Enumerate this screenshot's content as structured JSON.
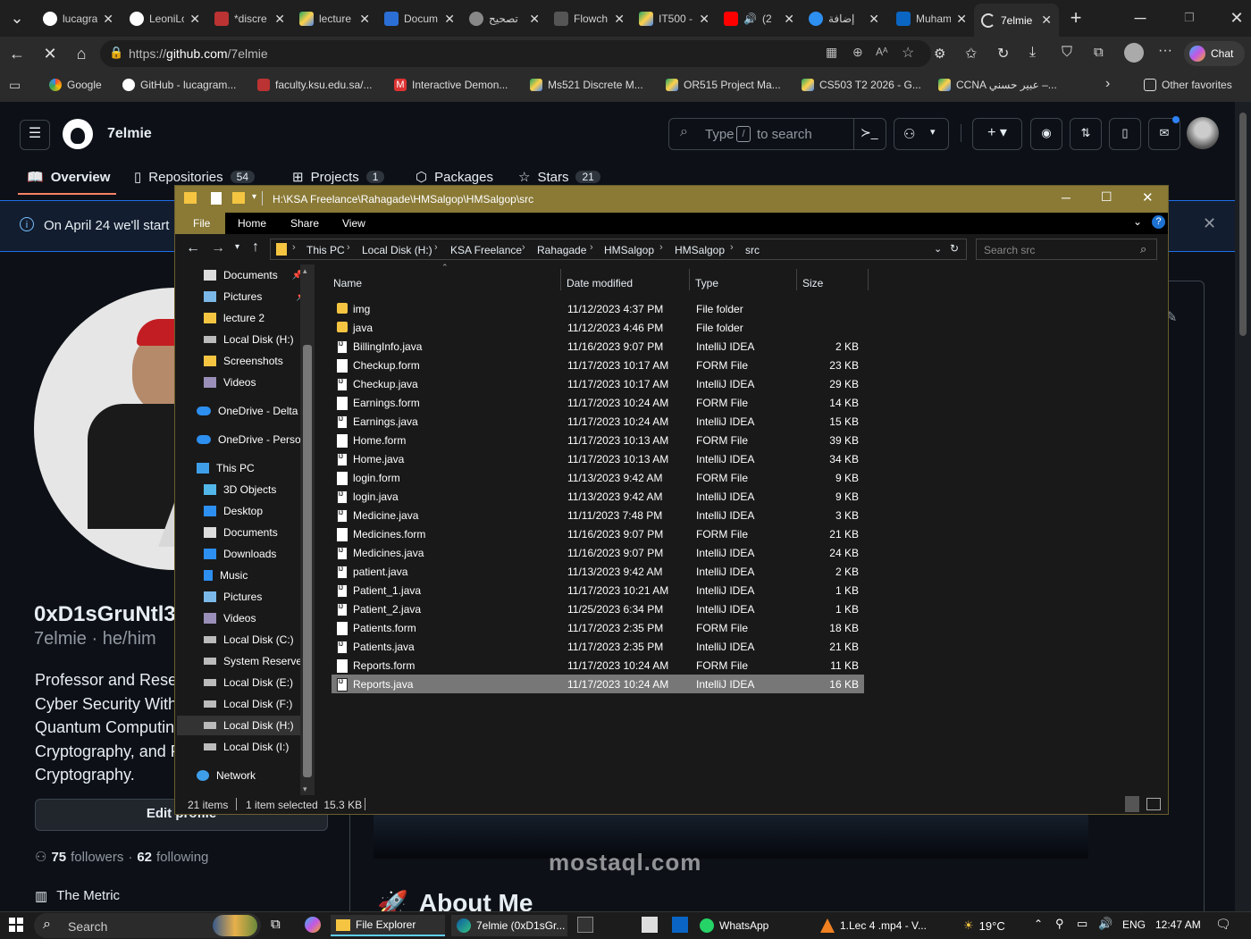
{
  "browser": {
    "tabs": [
      {
        "label": "lucagra"
      },
      {
        "label": "LeoniLo"
      },
      {
        "label": "*discre"
      },
      {
        "label": "lecture"
      },
      {
        "label": "Docum"
      },
      {
        "label": "تصحيح"
      },
      {
        "label": "Flowch"
      },
      {
        "label": "IT500 -"
      },
      {
        "label": "(2"
      },
      {
        "label": "إضافة"
      },
      {
        "label": "Muham"
      },
      {
        "label": "7elmie"
      }
    ],
    "url_prefix": "https://",
    "url_host": "github.com",
    "url_path": "/7elmie",
    "chat_label": "Chat",
    "favorites": [
      {
        "label": "Google"
      },
      {
        "label": "GitHub - lucagram..."
      },
      {
        "label": "faculty.ksu.edu.sa/..."
      },
      {
        "label": "Interactive Demon..."
      },
      {
        "label": "Ms521 Discrete M..."
      },
      {
        "label": "OR515 Project Ma..."
      },
      {
        "label": "CS503 T2 2026 - G..."
      },
      {
        "label": "CCNA عبير حسني –..."
      }
    ],
    "other_favorites": "Other favorites"
  },
  "github": {
    "username": "7elmie",
    "search_type": "Type",
    "search_key": "/",
    "search_suffix": "to search",
    "nav": [
      {
        "label": "Overview"
      },
      {
        "label": "Repositories",
        "count": "54"
      },
      {
        "label": "Projects",
        "count": "1"
      },
      {
        "label": "Packages"
      },
      {
        "label": "Stars",
        "count": "21"
      }
    ],
    "banner": "On April 24 we'll start",
    "profile_name": "0xD1sGruNtl3",
    "profile_login": "7elmie · he/him",
    "bio": [
      "Professor and Resea",
      "Cyber Security With",
      "Quantum Computin",
      "Cryptography, and P",
      "Cryptography."
    ],
    "edit_profile": "Edit profile",
    "followers_count": "75",
    "followers_label": "followers",
    "following_count": "62",
    "following_label": "following",
    "org": "The Metric",
    "about_heading": "About Me"
  },
  "explorer": {
    "title_path": "H:\\KSA Freelance\\Rahagade\\HMSalgop\\HMSalgop\\src",
    "ribbon_tabs": [
      "File",
      "Home",
      "Share",
      "View"
    ],
    "breadcrumb": [
      "This PC",
      "Local Disk (H:)",
      "KSA Freelance",
      "Rahagade",
      "HMSalgop",
      "HMSalgop",
      "src"
    ],
    "search_placeholder": "Search src",
    "nav_items": [
      {
        "label": "Documents",
        "icon": "documents-icon",
        "pinned": true
      },
      {
        "label": "Pictures",
        "icon": "pictures-icon",
        "pinned": true
      },
      {
        "label": "lecture 2",
        "icon": "folder-icon"
      },
      {
        "label": "Local Disk (H:)",
        "icon": "drive-icon"
      },
      {
        "label": "Screenshots",
        "icon": "folder-icon"
      },
      {
        "label": "Videos",
        "icon": "videos-icon"
      },
      {
        "label": "OneDrive - Delta T",
        "icon": "onedrive-icon",
        "top": true
      },
      {
        "label": "OneDrive - Person",
        "icon": "onedrive-icon",
        "top": true
      },
      {
        "label": "This PC",
        "icon": "pc-icon",
        "top": true
      },
      {
        "label": "3D Objects",
        "icon": "3d-icon"
      },
      {
        "label": "Desktop",
        "icon": "desktop-icon"
      },
      {
        "label": "Documents",
        "icon": "documents-icon"
      },
      {
        "label": "Downloads",
        "icon": "downloads-icon"
      },
      {
        "label": "Music",
        "icon": "music-icon"
      },
      {
        "label": "Pictures",
        "icon": "pictures-icon"
      },
      {
        "label": "Videos",
        "icon": "videos-icon"
      },
      {
        "label": "Local Disk (C:)",
        "icon": "drive-icon"
      },
      {
        "label": "System Reserved",
        "icon": "drive-icon"
      },
      {
        "label": "Local Disk (E:)",
        "icon": "drive-icon"
      },
      {
        "label": "Local Disk (F:)",
        "icon": "drive-icon"
      },
      {
        "label": "Local Disk (H:)",
        "icon": "drive-icon",
        "selected": true
      },
      {
        "label": "Local Disk (I:)",
        "icon": "drive-icon"
      },
      {
        "label": "Network",
        "icon": "network-icon",
        "top": true
      }
    ],
    "columns": [
      "Name",
      "Date modified",
      "Type",
      "Size"
    ],
    "files": [
      {
        "name": "img",
        "date": "11/12/2023 4:37 PM",
        "type": "File folder",
        "size": "",
        "kind": "folder"
      },
      {
        "name": "java",
        "date": "11/12/2023 4:46 PM",
        "type": "File folder",
        "size": "",
        "kind": "folder"
      },
      {
        "name": "BillingInfo.java",
        "date": "11/16/2023 9:07 PM",
        "type": "IntelliJ IDEA",
        "size": "2 KB",
        "kind": "java"
      },
      {
        "name": "Checkup.form",
        "date": "11/17/2023 10:17 AM",
        "type": "FORM File",
        "size": "23 KB",
        "kind": "form"
      },
      {
        "name": "Checkup.java",
        "date": "11/17/2023 10:17 AM",
        "type": "IntelliJ IDEA",
        "size": "29 KB",
        "kind": "java"
      },
      {
        "name": "Earnings.form",
        "date": "11/17/2023 10:24 AM",
        "type": "FORM File",
        "size": "14 KB",
        "kind": "form"
      },
      {
        "name": "Earnings.java",
        "date": "11/17/2023 10:24 AM",
        "type": "IntelliJ IDEA",
        "size": "15 KB",
        "kind": "java"
      },
      {
        "name": "Home.form",
        "date": "11/17/2023 10:13 AM",
        "type": "FORM File",
        "size": "39 KB",
        "kind": "form"
      },
      {
        "name": "Home.java",
        "date": "11/17/2023 10:13 AM",
        "type": "IntelliJ IDEA",
        "size": "34 KB",
        "kind": "java"
      },
      {
        "name": "login.form",
        "date": "11/13/2023 9:42 AM",
        "type": "FORM File",
        "size": "9 KB",
        "kind": "form"
      },
      {
        "name": "login.java",
        "date": "11/13/2023 9:42 AM",
        "type": "IntelliJ IDEA",
        "size": "9 KB",
        "kind": "java"
      },
      {
        "name": "Medicine.java",
        "date": "11/11/2023 7:48 PM",
        "type": "IntelliJ IDEA",
        "size": "3 KB",
        "kind": "java"
      },
      {
        "name": "Medicines.form",
        "date": "11/16/2023 9:07 PM",
        "type": "FORM File",
        "size": "21 KB",
        "kind": "form"
      },
      {
        "name": "Medicines.java",
        "date": "11/16/2023 9:07 PM",
        "type": "IntelliJ IDEA",
        "size": "24 KB",
        "kind": "java"
      },
      {
        "name": "patient.java",
        "date": "11/13/2023 9:42 AM",
        "type": "IntelliJ IDEA",
        "size": "2 KB",
        "kind": "java"
      },
      {
        "name": "Patient_1.java",
        "date": "11/17/2023 10:21 AM",
        "type": "IntelliJ IDEA",
        "size": "1 KB",
        "kind": "java"
      },
      {
        "name": "Patient_2.java",
        "date": "11/25/2023 6:34 PM",
        "type": "IntelliJ IDEA",
        "size": "1 KB",
        "kind": "java"
      },
      {
        "name": "Patients.form",
        "date": "11/17/2023 2:35 PM",
        "type": "FORM File",
        "size": "18 KB",
        "kind": "form"
      },
      {
        "name": "Patients.java",
        "date": "11/17/2023 2:35 PM",
        "type": "IntelliJ IDEA",
        "size": "21 KB",
        "kind": "java"
      },
      {
        "name": "Reports.form",
        "date": "11/17/2023 10:24 AM",
        "type": "FORM File",
        "size": "11 KB",
        "kind": "form"
      },
      {
        "name": "Reports.java",
        "date": "11/17/2023 10:24 AM",
        "type": "IntelliJ IDEA",
        "size": "16 KB",
        "kind": "java",
        "selected": true
      }
    ],
    "status_items": "21 items",
    "status_selected": "1 item selected  15.3 KB"
  },
  "taskbar": {
    "search": "Search",
    "apps": [
      {
        "label": "File Explorer"
      },
      {
        "label": "7elmie (0xD1sGr..."
      },
      {
        "label": "WhatsApp"
      },
      {
        "label": "1.Lec 4 .mp4 - V..."
      }
    ],
    "weather": "19°C",
    "lang": "ENG",
    "time": "12:47 AM"
  },
  "watermark": "mostaql.com",
  "colors": {
    "explorer_title": "#8a7a36",
    "selection": "#777777",
    "accent": "#2f81f7"
  }
}
